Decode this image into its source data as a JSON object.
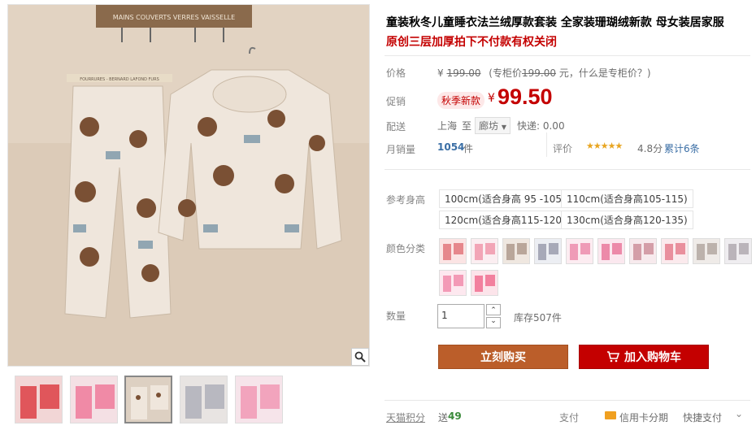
{
  "product": {
    "title": "童装秋冬儿童睡衣法兰绒厚款套装 全家装珊瑚绒新款 母女装居家服",
    "subtitle": "原创三层加厚拍下不付款有权关闭"
  },
  "price": {
    "label": "价格",
    "currency": "¥",
    "value": "199.00",
    "note_open": "(专柜价",
    "note_value": "199.00",
    "note_tail": "元，什么是专柜价？)"
  },
  "promo": {
    "label": "促销",
    "badge": "秋季新款",
    "currency": "¥",
    "value": "99.50"
  },
  "delivery": {
    "label": "配送",
    "from": "上海",
    "to_word": "至",
    "dest": "廊坊",
    "express": "快递: 0.00"
  },
  "sales": {
    "label": "月销量",
    "count": "1054",
    "unit": "件",
    "review_label": "评价",
    "stars": "★★★★★",
    "rating": "4.8分",
    "total": "累计6条"
  },
  "sizes": {
    "label": "参考身高",
    "options": [
      "100cm(适合身高 95 -105)",
      "110cm(适合身高105-115)",
      "120cm(适合身高115-120)",
      "130cm(适合身高120-135)"
    ]
  },
  "colors": {
    "label": "颜色分类",
    "count": 12
  },
  "quantity": {
    "label": "数量",
    "value": "1",
    "stock": "库存507件",
    "up": "⌃",
    "down": "⌄"
  },
  "buttons": {
    "buy": "立刻购买",
    "cart": "加入购物车",
    "cart_icon": "cart-icon"
  },
  "footer": {
    "points_label": "天猫积分",
    "points_prefix": "送",
    "points": "49",
    "pay_label": "支付",
    "credit": "信用卡分期",
    "quick": "快捷支付",
    "chevron": "⌄"
  },
  "image": {
    "sign_text": "MAINS  COUVERTS  VERRES  VAISSELLE",
    "hanger_text": "FOURRURES - BERNARD LAFOND FURS"
  },
  "colors_theme": {
    "accent": "#c40000",
    "buy": "#bb5e2a",
    "cart": "#c40000"
  }
}
